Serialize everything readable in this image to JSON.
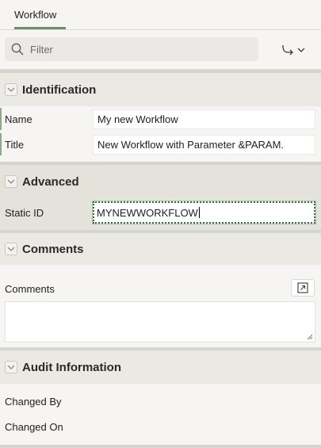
{
  "tabs": [
    {
      "label": "Workflow"
    }
  ],
  "search": {
    "placeholder": "Filter"
  },
  "sections": {
    "identification": {
      "title": "Identification",
      "fields": {
        "name": {
          "label": "Name",
          "value": "My new Workflow"
        },
        "title": {
          "label": "Title",
          "value": "New Workflow with Parameter &PARAM."
        }
      }
    },
    "advanced": {
      "title": "Advanced",
      "fields": {
        "static_id": {
          "label": "Static ID",
          "value": "MYNEWWORKFLOW"
        }
      }
    },
    "comments": {
      "title": "Comments",
      "fields": {
        "comments": {
          "label": "Comments",
          "value": ""
        }
      }
    },
    "audit": {
      "title": "Audit Information",
      "fields": {
        "changed_by": {
          "label": "Changed By",
          "value": ""
        },
        "changed_on": {
          "label": "Changed On",
          "value": ""
        }
      }
    }
  },
  "icons": {
    "search": "search-icon",
    "goto": "goto-arrow-icon",
    "collapse": "chevron-down-icon",
    "expand": "expand-icon"
  },
  "colors": {
    "accent": "#6a8f6a",
    "background": "#f6f5f3",
    "section_header": "#ebe9e4",
    "advanced_bg": "#e3e2db"
  }
}
